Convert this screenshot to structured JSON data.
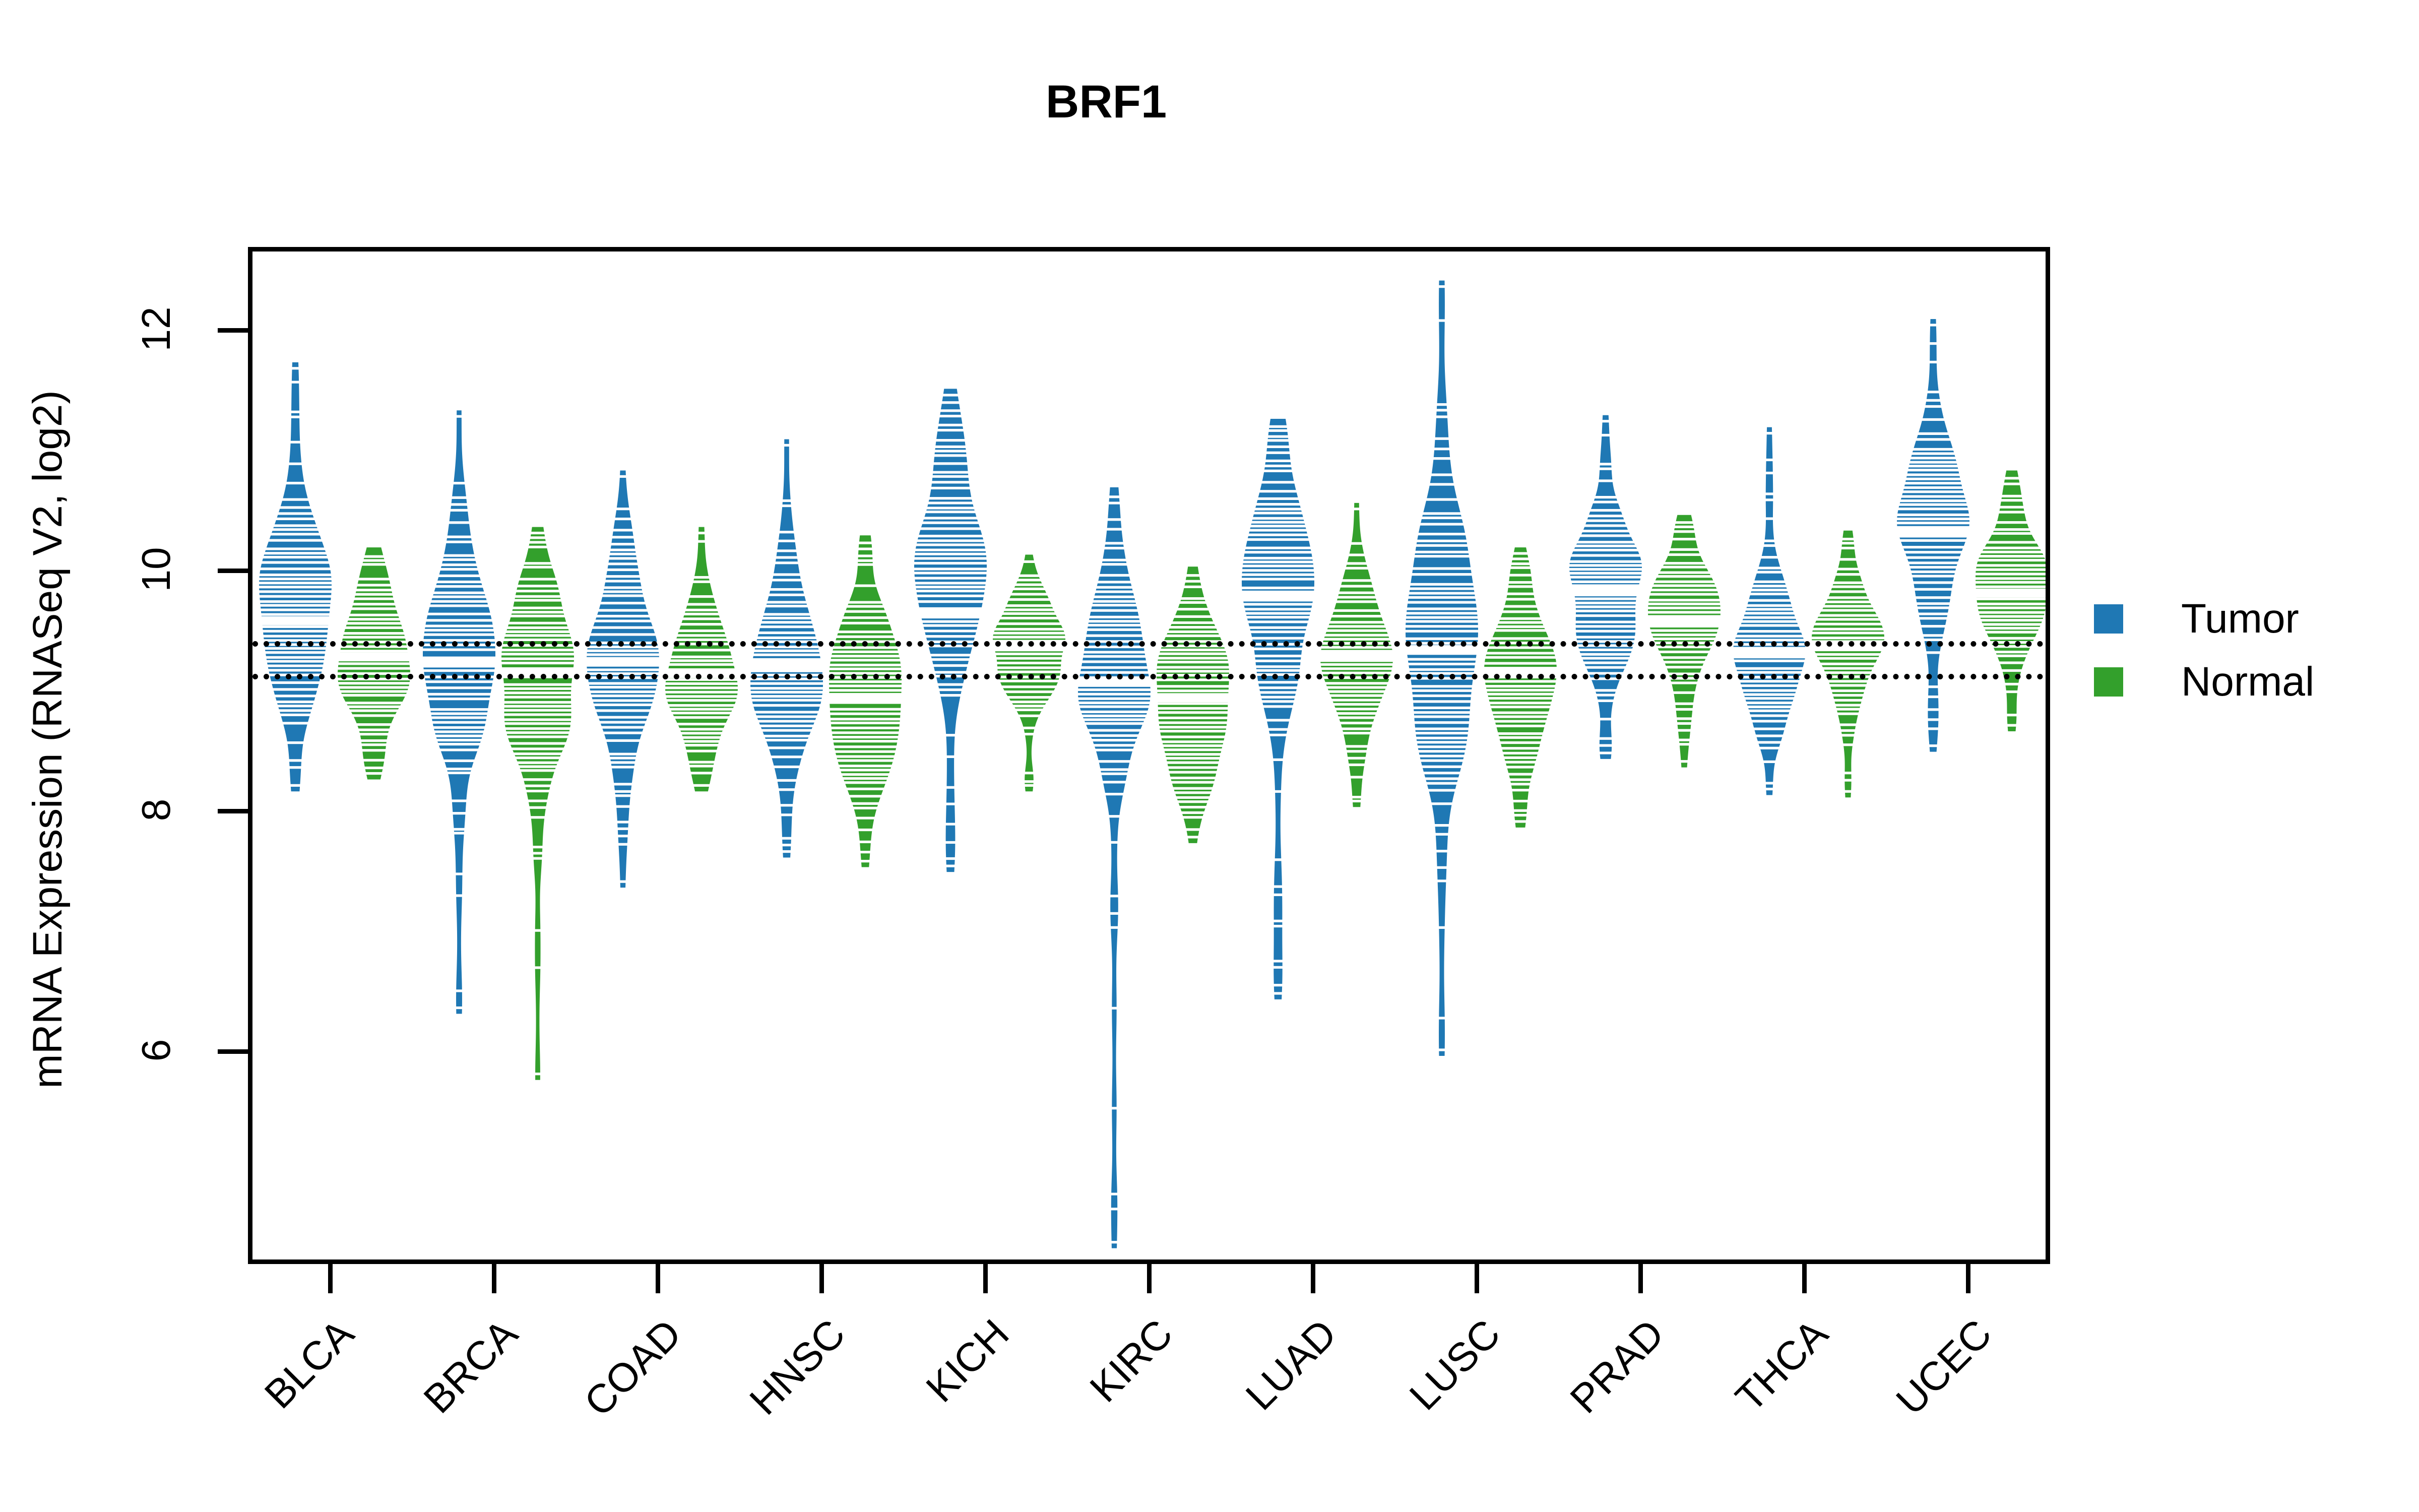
{
  "chart_data": {
    "type": "violin",
    "title": "BRF1",
    "xlabel": "",
    "ylabel": "mRNA Expression (RNASeq V2, log2)",
    "ylim": [
      4.2,
      12.8
    ],
    "yticks": [
      6,
      8,
      10,
      12
    ],
    "ytick_labels": [
      "6",
      "8",
      "10",
      "12"
    ],
    "grid": false,
    "legend_position": "right",
    "categories": [
      "BLCA",
      "BRCA",
      "COAD",
      "HNSC",
      "KICH",
      "KIRC",
      "LUAD",
      "LUSC",
      "PRAD",
      "THCA",
      "UCEC"
    ],
    "reference_lines": [
      9.45,
      9.18
    ],
    "series": [
      {
        "name": "Tumor",
        "color": "#1F78B4",
        "stats": [
          {
            "category": "BLCA",
            "median": 9.62,
            "q1": 9.15,
            "q3": 10.05,
            "min": 8.25,
            "max": 11.72,
            "mode": 9.85,
            "spread": 0.62
          },
          {
            "category": "BRCA",
            "median": 9.28,
            "q1": 8.85,
            "q3": 9.8,
            "min": 6.4,
            "max": 11.32,
            "mode": 9.3,
            "spread": 0.72
          },
          {
            "category": "COAD",
            "median": 9.28,
            "q1": 8.8,
            "q3": 9.72,
            "min": 7.45,
            "max": 10.82,
            "mode": 9.28,
            "spread": 0.66
          },
          {
            "category": "HNSC",
            "median": 9.25,
            "q1": 8.88,
            "q3": 9.7,
            "min": 7.7,
            "max": 11.08,
            "mode": 9.28,
            "spread": 0.6
          },
          {
            "category": "KICH",
            "median": 9.68,
            "q1": 9.35,
            "q3": 10.4,
            "min": 7.58,
            "max": 11.5,
            "mode": 10.18,
            "spread": 0.55
          },
          {
            "category": "KIRC",
            "median": 9.12,
            "q1": 8.72,
            "q3": 9.62,
            "min": 4.45,
            "max": 10.68,
            "mode": 9.18,
            "spread": 0.6
          },
          {
            "category": "LUAD",
            "median": 9.82,
            "q1": 9.3,
            "q3": 10.28,
            "min": 6.52,
            "max": 11.25,
            "mode": 9.92,
            "spread": 0.62
          },
          {
            "category": "LUSC",
            "median": 9.38,
            "q1": 8.85,
            "q3": 10.02,
            "min": 6.05,
            "max": 12.4,
            "mode": 9.55,
            "spread": 0.72
          },
          {
            "category": "PRAD",
            "median": 9.88,
            "q1": 9.55,
            "q3": 10.22,
            "min": 8.52,
            "max": 11.28,
            "mode": 9.92,
            "spread": 0.5
          },
          {
            "category": "THCA",
            "median": 9.35,
            "q1": 9.08,
            "q3": 9.68,
            "min": 8.22,
            "max": 11.18,
            "mode": 9.38,
            "spread": 0.45
          },
          {
            "category": "UCEC",
            "median": 10.35,
            "q1": 9.95,
            "q3": 10.72,
            "min": 8.58,
            "max": 12.08,
            "mode": 10.48,
            "spread": 0.6
          }
        ]
      },
      {
        "name": "Normal",
        "color": "#33A02C",
        "stats": [
          {
            "category": "BLCA",
            "median": 9.32,
            "q1": 9.0,
            "q3": 9.7,
            "min": 8.35,
            "max": 10.18,
            "mode": 9.22,
            "spread": 0.48
          },
          {
            "category": "BRCA",
            "median": 9.18,
            "q1": 8.8,
            "q3": 9.62,
            "min": 5.85,
            "max": 10.35,
            "mode": 9.12,
            "spread": 0.55
          },
          {
            "category": "COAD",
            "median": 9.18,
            "q1": 8.85,
            "q3": 9.55,
            "min": 8.25,
            "max": 10.35,
            "mode": 9.18,
            "spread": 0.45
          },
          {
            "category": "HNSC",
            "median": 8.98,
            "q1": 8.65,
            "q3": 9.45,
            "min": 7.62,
            "max": 10.28,
            "mode": 9.0,
            "spread": 0.5
          },
          {
            "category": "KICH",
            "median": 9.42,
            "q1": 9.18,
            "q3": 9.65,
            "min": 8.25,
            "max": 10.12,
            "mode": 9.42,
            "spread": 0.38
          },
          {
            "category": "KIRC",
            "median": 8.98,
            "q1": 8.65,
            "q3": 9.4,
            "min": 7.82,
            "max": 10.02,
            "mode": 8.95,
            "spread": 0.45
          },
          {
            "category": "LUAD",
            "median": 9.32,
            "q1": 9.0,
            "q3": 9.68,
            "min": 8.12,
            "max": 10.55,
            "mode": 9.28,
            "spread": 0.45
          },
          {
            "category": "LUSC",
            "median": 9.18,
            "q1": 8.85,
            "q3": 9.55,
            "min": 7.95,
            "max": 10.18,
            "mode": 9.18,
            "spread": 0.45
          },
          {
            "category": "PRAD",
            "median": 9.62,
            "q1": 9.3,
            "q3": 9.92,
            "min": 8.45,
            "max": 10.45,
            "mode": 9.62,
            "spread": 0.42
          },
          {
            "category": "THCA",
            "median": 9.42,
            "q1": 9.15,
            "q3": 9.72,
            "min": 8.2,
            "max": 10.32,
            "mode": 9.45,
            "spread": 0.42
          },
          {
            "category": "UCEC",
            "median": 9.85,
            "q1": 9.55,
            "q3": 10.15,
            "min": 8.75,
            "max": 10.82,
            "mode": 9.95,
            "spread": 0.45
          }
        ]
      }
    ]
  },
  "title": {
    "text": "BRF1"
  },
  "axes": {
    "y_title": "mRNA Expression (RNASeq V2, log2)",
    "y_tick_labels": [
      "12",
      "10",
      "8",
      "6"
    ],
    "x_tick_labels": [
      "BLCA",
      "BRCA",
      "COAD",
      "HNSC",
      "KICH",
      "KIRC",
      "LUAD",
      "LUSC",
      "PRAD",
      "THCA",
      "UCEC"
    ]
  },
  "legend": {
    "items": [
      {
        "label": "Tumor",
        "color": "#1F78B4"
      },
      {
        "label": "Normal",
        "color": "#33A02C"
      }
    ]
  }
}
